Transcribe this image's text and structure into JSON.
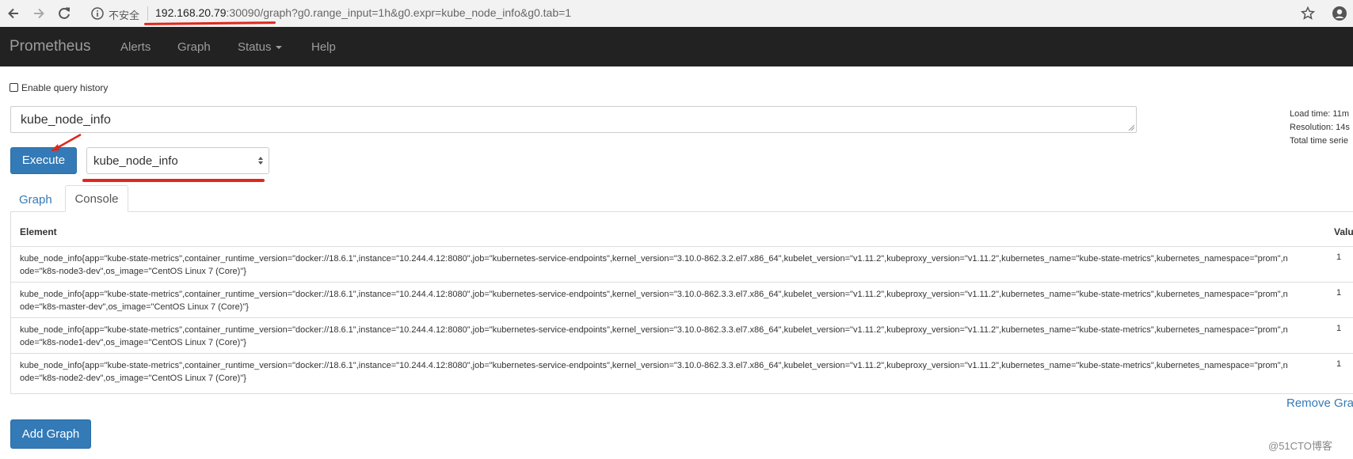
{
  "browser": {
    "insecure_label": "不安全",
    "url_host": "192.168.20.79",
    "url_rest": ":30090/graph?g0.range_input=1h&g0.expr=kube_node_info&g0.tab=1"
  },
  "navbar": {
    "brand": "Prometheus",
    "links": [
      "Alerts",
      "Graph",
      "Status",
      "Help"
    ]
  },
  "query": {
    "history_label": "Enable query history",
    "history_checked": false,
    "expression": "kube_node_info",
    "execute_label": "Execute",
    "metric_selected": "kube_node_info"
  },
  "stats": {
    "load_time": "Load time: 11m",
    "resolution": "Resolution: 14s",
    "total_series": "Total time serie"
  },
  "tabs": {
    "graph": "Graph",
    "console": "Console",
    "active": "Console"
  },
  "table": {
    "headers": {
      "element": "Element",
      "value": "Valu"
    },
    "rows": [
      {
        "element": "kube_node_info{app=\"kube-state-metrics\",container_runtime_version=\"docker://18.6.1\",instance=\"10.244.4.12:8080\",job=\"kubernetes-service-endpoints\",kernel_version=\"3.10.0-862.3.2.el7.x86_64\",kubelet_version=\"v1.11.2\",kubeproxy_version=\"v1.11.2\",kubernetes_name=\"kube-state-metrics\",kubernetes_namespace=\"prom\",node=\"k8s-node3-dev\",os_image=\"CentOS Linux 7 (Core)\"}",
        "value": "1"
      },
      {
        "element": "kube_node_info{app=\"kube-state-metrics\",container_runtime_version=\"docker://18.6.1\",instance=\"10.244.4.12:8080\",job=\"kubernetes-service-endpoints\",kernel_version=\"3.10.0-862.3.3.el7.x86_64\",kubelet_version=\"v1.11.2\",kubeproxy_version=\"v1.11.2\",kubernetes_name=\"kube-state-metrics\",kubernetes_namespace=\"prom\",node=\"k8s-master-dev\",os_image=\"CentOS Linux 7 (Core)\"}",
        "value": "1"
      },
      {
        "element": "kube_node_info{app=\"kube-state-metrics\",container_runtime_version=\"docker://18.6.1\",instance=\"10.244.4.12:8080\",job=\"kubernetes-service-endpoints\",kernel_version=\"3.10.0-862.3.3.el7.x86_64\",kubelet_version=\"v1.11.2\",kubeproxy_version=\"v1.11.2\",kubernetes_name=\"kube-state-metrics\",kubernetes_namespace=\"prom\",node=\"k8s-node1-dev\",os_image=\"CentOS Linux 7 (Core)\"}",
        "value": "1"
      },
      {
        "element": "kube_node_info{app=\"kube-state-metrics\",container_runtime_version=\"docker://18.6.1\",instance=\"10.244.4.12:8080\",job=\"kubernetes-service-endpoints\",kernel_version=\"3.10.0-862.3.3.el7.x86_64\",kubelet_version=\"v1.11.2\",kubeproxy_version=\"v1.11.2\",kubernetes_name=\"kube-state-metrics\",kubernetes_namespace=\"prom\",node=\"k8s-node2-dev\",os_image=\"CentOS Linux 7 (Core)\"}",
        "value": "1"
      }
    ]
  },
  "actions": {
    "remove_graph": "Remove Gra",
    "add_graph": "Add Graph"
  },
  "watermark": "@51CTO博客",
  "colors": {
    "navbar_bg": "#222222",
    "primary": "#337ab7",
    "annotation_red": "#e0271c"
  }
}
